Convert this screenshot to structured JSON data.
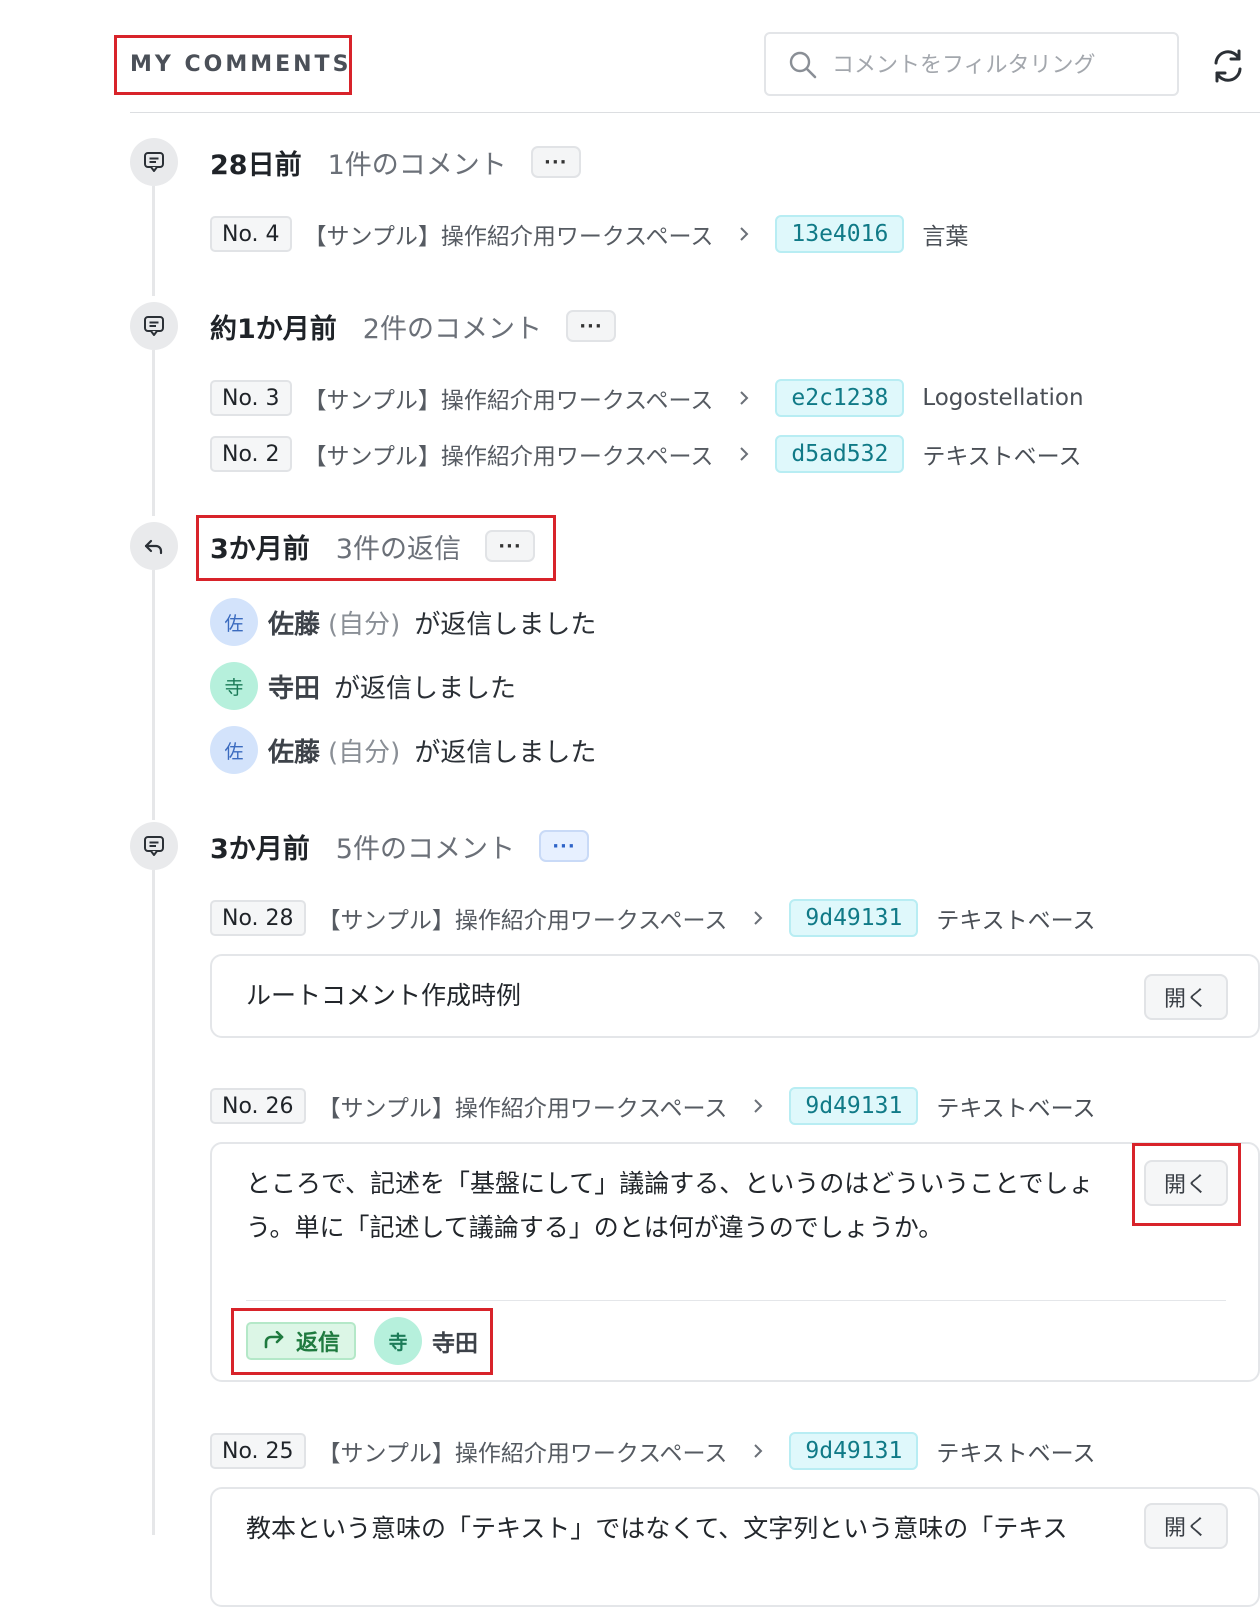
{
  "header": {
    "title": "MY COMMENTS",
    "search_placeholder": "コメントをフィルタリング",
    "icons": [
      "search-icon",
      "refresh-icon"
    ]
  },
  "groups": [
    {
      "icon": "comment-icon",
      "date": "28日前",
      "count": "1件のコメント",
      "more": "···",
      "items": [
        {
          "no": "No. 4",
          "workspace": "【サンプル】操作紹介用ワークスペース",
          "hash": "13e4016",
          "doc": "言葉"
        }
      ]
    },
    {
      "icon": "comment-icon",
      "date": "約1か月前",
      "count": "2件のコメント",
      "more": "···",
      "items": [
        {
          "no": "No. 3",
          "workspace": "【サンプル】操作紹介用ワークスペース",
          "hash": "e2c1238",
          "doc": "Logostellation"
        },
        {
          "no": "No. 2",
          "workspace": "【サンプル】操作紹介用ワークスペース",
          "hash": "d5ad532",
          "doc": "テキストベース"
        }
      ]
    },
    {
      "icon": "reply-icon",
      "date": "3か月前",
      "count": "3件の返信",
      "more": "···",
      "replies": [
        {
          "avatar": "佐",
          "name": "佐藤",
          "self": "(自分)",
          "action": "が返信しました"
        },
        {
          "avatar": "寺",
          "name": "寺田",
          "self": "",
          "action": "が返信しました"
        },
        {
          "avatar": "佐",
          "name": "佐藤",
          "self": "(自分)",
          "action": "が返信しました"
        }
      ]
    },
    {
      "icon": "comment-icon",
      "date": "3か月前",
      "count": "5件のコメント",
      "more": "···",
      "items": [
        {
          "no": "No. 28",
          "workspace": "【サンプル】操作紹介用ワークスペース",
          "hash": "9d49131",
          "doc": "テキストベース",
          "text": "ルートコメント作成時例",
          "open": "開く"
        },
        {
          "no": "No. 26",
          "workspace": "【サンプル】操作紹介用ワークスペース",
          "hash": "9d49131",
          "doc": "テキストベース",
          "text": "ところで、記述を「基盤にして」議論する、というのはどういうことでしょう。単に「記述して議論する」のとは何が違うのでしょうか。",
          "open": "開く",
          "reply_label": "返信",
          "reply_avatar": "寺",
          "reply_user": "寺田"
        },
        {
          "no": "No. 25",
          "workspace": "【サンプル】操作紹介用ワークスペース",
          "hash": "9d49131",
          "doc": "テキストベース",
          "text": "教本という意味の「テキスト」ではなくて、文字列という意味の「テキス",
          "open": "開く"
        }
      ]
    }
  ],
  "colors": {
    "highlight_border": "#d8232a",
    "hash_bg": "#dff8fb",
    "reply_green": "#1f7a3f"
  }
}
